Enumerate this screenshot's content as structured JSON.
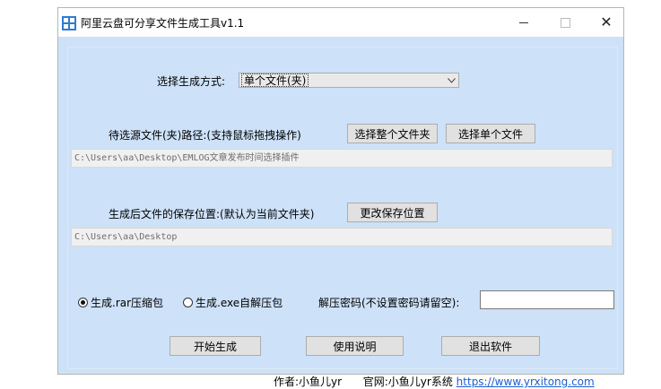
{
  "window": {
    "title": "阿里云盘可分享文件生成工具v1.1",
    "icon": "app-icon",
    "controls": {
      "minimize": "minimize-icon",
      "maximize": "maximize-icon",
      "close": "close-icon"
    }
  },
  "mode": {
    "label": "选择生成方式:",
    "selected": "单个文件(夹)"
  },
  "source": {
    "label": "待选源文件(夹)路径:(支持鼠标拖拽操作)",
    "select_folder_button": "选择整个文件夹",
    "select_file_button": "选择单个文件",
    "path_value": "C:\\Users\\aa\\Desktop\\EMLOG文章发布时间选择插件"
  },
  "output": {
    "label": "生成后文件的保存位置:(默认为当前文件夹)",
    "change_button": "更改保存位置",
    "path_value": "C:\\Users\\aa\\Desktop"
  },
  "options": {
    "radio_rar": "生成.rar压缩包",
    "radio_exe": "生成.exe自解压包",
    "rar_selected": true,
    "password_label": "解压密码(不设置密码请留空):",
    "password_value": ""
  },
  "actions": {
    "start": "开始生成",
    "help": "使用说明",
    "exit": "退出软件"
  },
  "footer": {
    "author": "作者:小鱼儿yr",
    "site_label": "官网:小鱼儿yr系统",
    "site_link": "https://www.yrxitong.com"
  },
  "colors": {
    "client_bg": "#cde1f8",
    "link": "#1a5fd0"
  }
}
